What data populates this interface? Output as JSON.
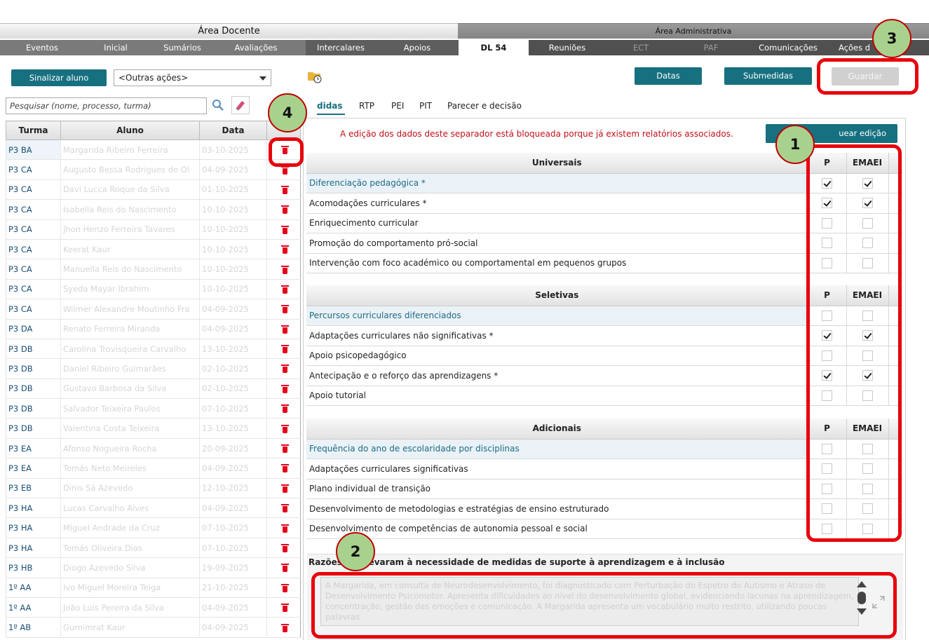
{
  "header": {
    "area_docente": "Área Docente",
    "area_administrativa": "Área Administrativa",
    "tabs": [
      "Eventos",
      "Inicial",
      "Sumários",
      "Avaliações",
      "Intercalares",
      "Apoios",
      "DL 54",
      "Reuniões",
      "ECT",
      "PAF",
      "Comunicações",
      "Ações d"
    ]
  },
  "toolbar": {
    "sinalizar": "Sinalizar aluno",
    "outras_acoes": "<Outras ações>",
    "datas": "Datas",
    "submedidas": "Submedidas",
    "guardar": "Guardar",
    "search_placeholder": "Pesquisar (nome, processo, turma)"
  },
  "students": {
    "headers": [
      "Turma",
      "Aluno",
      "Data"
    ],
    "rows": [
      [
        "P3 BA",
        "Margarida Ribeiro Ferreira",
        "03-10-2025"
      ],
      [
        "P3 CA",
        "Augusto Bessa Rodrigues de Ol",
        "04-09-2025"
      ],
      [
        "P3 CA",
        "Davi Lucca Roque da Silva",
        "01-10-2025"
      ],
      [
        "P3 CA",
        "Isabella Reis do Nascimento",
        "10-10-2025"
      ],
      [
        "P3 CA",
        "Jhon Henzo Ferreira Tavares",
        "10-10-2025"
      ],
      [
        "P3 CA",
        "Keerat Kaur",
        "10-10-2025"
      ],
      [
        "P3 CA",
        "Manuella Reis do Nascimento",
        "10-10-2025"
      ],
      [
        "P3 CA",
        "Syeda Mayar Ibrahim",
        "10-10-2025"
      ],
      [
        "P3 CA",
        "Wilmer Alexandre Moutinho Fra",
        "04-09-2025"
      ],
      [
        "P3 DA",
        "Renato Ferreira Miranda",
        "04-09-2025"
      ],
      [
        "P3 DB",
        "Carolina Trovisqueira Carvalho",
        "13-10-2025"
      ],
      [
        "P3 DB",
        "Daniel Ribeiro Guimarães",
        "02-10-2025"
      ],
      [
        "P3 DB",
        "Gustavo Barbosa da Silva",
        "02-10-2025"
      ],
      [
        "P3 DB",
        "Salvador Teixeira Paulos",
        "07-10-2025"
      ],
      [
        "P3 DB",
        "Valentina Costa Teixeira",
        "13-10-2025"
      ],
      [
        "P3 EA",
        "Afonso Nogueira Rocha",
        "20-09-2025"
      ],
      [
        "P3 EA",
        "Tomás Neto Meireles",
        "04-09-2025"
      ],
      [
        "P3 EB",
        "Dinis Sá Azevedo",
        "12-10-2025"
      ],
      [
        "P3 HA",
        "Lucas Carvalho Alves",
        "04-09-2025"
      ],
      [
        "P3 HA",
        "Miguel Andrade da Cruz",
        "07-10-2025"
      ],
      [
        "P3 HA",
        "Tomás Oliveira Dias",
        "07-10-2025"
      ],
      [
        "P3 HB",
        "Diogo Azevedo Silva",
        "19-09-2025"
      ],
      [
        "1º AA",
        "Ivo Miguel Moreira Teiga",
        "21-10-2025"
      ],
      [
        "1º AA",
        "João Luís Pereira da Silva",
        "04-09-2025"
      ],
      [
        "1º AB",
        "Gurnimrat Kaur",
        "04-09-2025"
      ]
    ]
  },
  "subtabs": [
    "didas",
    "RTP",
    "PEI",
    "PIT",
    "Parecer e decisão"
  ],
  "locked_msg": "A edição dos dados deste separador está bloqueada porque já existem relatórios associados.",
  "unlock_btn": "uear edição",
  "col_p": "P",
  "col_emaei": "EMAEI",
  "sections": [
    {
      "title": "Universais",
      "items": [
        {
          "label": "Diferenciação pedagógica *",
          "p": true,
          "e": true
        },
        {
          "label": "Acomodações curriculares *",
          "p": true,
          "e": true
        },
        {
          "label": "Enriquecimento curricular",
          "p": false,
          "e": false
        },
        {
          "label": "Promoção do comportamento pró-social",
          "p": false,
          "e": false
        },
        {
          "label": "Intervenção com foco académico ou comportamental em pequenos grupos",
          "p": false,
          "e": false
        }
      ]
    },
    {
      "title": "Seletivas",
      "items": [
        {
          "label": "Percursos curriculares diferenciados",
          "p": false,
          "e": false
        },
        {
          "label": "Adaptações curriculares não significativas *",
          "p": true,
          "e": true
        },
        {
          "label": "Apoio psicopedagógico",
          "p": false,
          "e": false
        },
        {
          "label": "Antecipação e o reforço das aprendizagens *",
          "p": true,
          "e": true
        },
        {
          "label": "Apoio tutorial",
          "p": false,
          "e": false
        }
      ]
    },
    {
      "title": "Adicionais",
      "items": [
        {
          "label": "Frequência do ano de escolaridade por disciplinas",
          "p": false,
          "e": false
        },
        {
          "label": "Adaptações curriculares significativas",
          "p": false,
          "e": false
        },
        {
          "label": "Plano individual de transição",
          "p": false,
          "e": false
        },
        {
          "label": "Desenvolvimento de metodologias e estratégias de ensino estruturado",
          "p": false,
          "e": false
        },
        {
          "label": "Desenvolvimento de competências de autonomia pessoal e social",
          "p": false,
          "e": false
        }
      ]
    }
  ],
  "razoes_label": "Razões que levaram à necessidade de medidas de suporte à aprendizagem e à inclusão",
  "razoes_text": "A Margarida, em consulta de Neurodesenvolvimento, foi diagnosticado com Perturbação do Espetro do Autismo e Atraso de Desenvolvimento Psicomotor. Apresenta dificuldades ao nível do desenvolvimento global, evidenciando lacunas na aprendizagem, concentração, gestão das emoções e comunicação. A Margarida apresenta um vocabulário muito restrito, utilizando poucas palavras",
  "annotations": [
    "1",
    "2",
    "3",
    "4"
  ]
}
